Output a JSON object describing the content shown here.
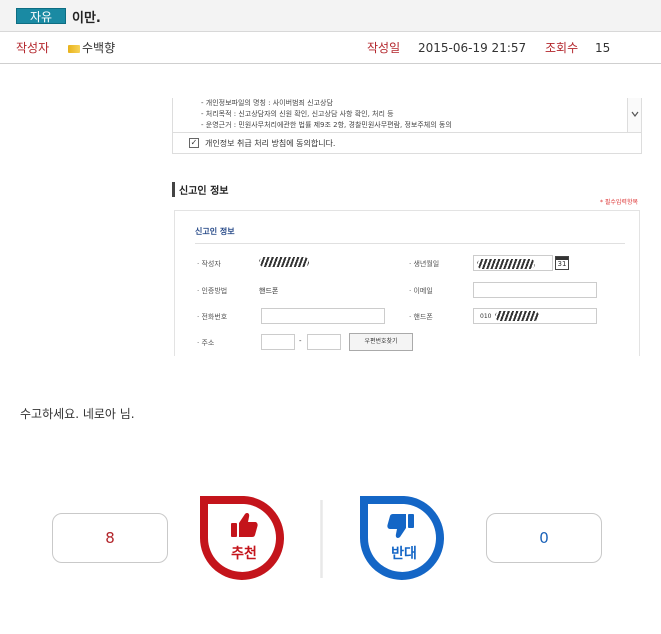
{
  "header": {
    "category": "자유",
    "title": "이만."
  },
  "meta": {
    "author_label": "작성자",
    "author": "수백향",
    "date_label": "작성일",
    "date": "2015-06-19 21:57",
    "views_label": "조회수",
    "views": "15"
  },
  "screenshot": {
    "terms_lines": [
      "- 개인정보파일의 명칭 : 사이버범죄 신고상담",
      "- 처리목적 : 신고상담자의 신원 확인, 신고상담 사항 확인, 처리 등",
      "- 운영근거 : 민원사무처리에관한 법률 제9조 2항, 경찰민원사무편람, 정보주체의 동의"
    ],
    "agree_text": "개인정보 취급 처리 방침에 동의합니다.",
    "section_title": "신고인 정보",
    "required_note": "* 필수입력항목",
    "form_title": "신고인 정보",
    "fields": {
      "writer": "· 작성자",
      "birth": "· 생년월일",
      "auth": "· 인증방법",
      "auth_value": "핸드폰",
      "email": "· 이메일",
      "phone": "· 전화번호",
      "mobile": "· 핸드폰",
      "mobile_prefix": "010",
      "address": "· 주소",
      "zip_sep": "-",
      "zip_button": "우편번호찾기"
    },
    "calendar_day": "31"
  },
  "content": {
    "text": "수고하세요. 네로아 님."
  },
  "vote": {
    "up_count": "8",
    "up_label": "추천",
    "down_count": "0",
    "down_label": "반대",
    "up_color": "#c4141b",
    "down_color": "#1466c6"
  }
}
